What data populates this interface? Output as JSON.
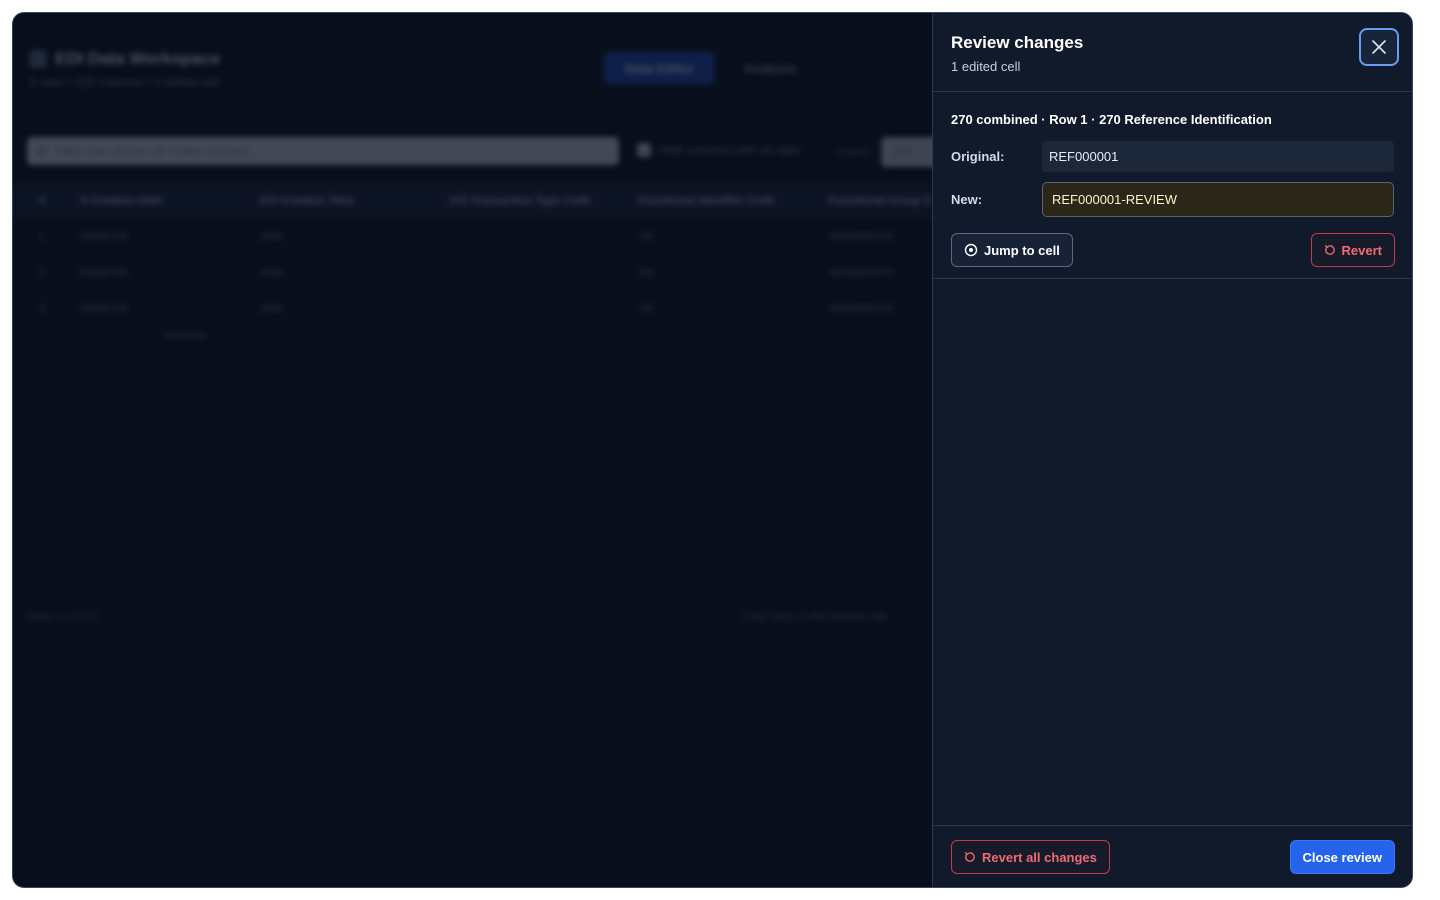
{
  "workspace": {
    "title": "EDI Data Workspace",
    "subtitle": "3 rows • 325 columns • 1 edited cell",
    "tabs": [
      "Data Editor",
      "Analysis"
    ],
    "search_placeholder": "Filter rows across all visible columns…",
    "hide_empty_label": "Hide columns with no data",
    "layout_label": "Layout",
    "layout_value": "270",
    "columns": [
      "#",
      "'0 Creation Date",
      "270 Creation Time",
      "270 Transaction Type Code",
      "Functional Identifier Code",
      "Functional Group S"
    ],
    "rows": [
      [
        "1",
        "20260726",
        "1000",
        "",
        "HS",
        "SENDER279"
      ],
      [
        "2",
        "20260726",
        "1000",
        "",
        "HS",
        "SENDER279"
      ],
      [
        "3",
        "20260726",
        "1000",
        "",
        "HS",
        "SENDER279"
      ]
    ],
    "footer_left": "Rows 1–3 of 3",
    "footer_right": "Data stays in this browser tab"
  },
  "review": {
    "title": "Review changes",
    "subtitle": "1 edited cell",
    "change": {
      "title": "270 combined · Row 1 · 270 Reference Identification",
      "original_label": "Original:",
      "original_value": "REF000001",
      "new_label": "New:",
      "new_value": "REF000001-REVIEW",
      "jump_label": "Jump to cell",
      "revert_label": "Revert"
    },
    "revert_all_label": "Revert all changes",
    "close_review_label": "Close review"
  },
  "colors": {
    "accent": "#2563eb",
    "danger": "#f06b76",
    "panel": "#111a2b",
    "backdrop": "#0b1120"
  }
}
